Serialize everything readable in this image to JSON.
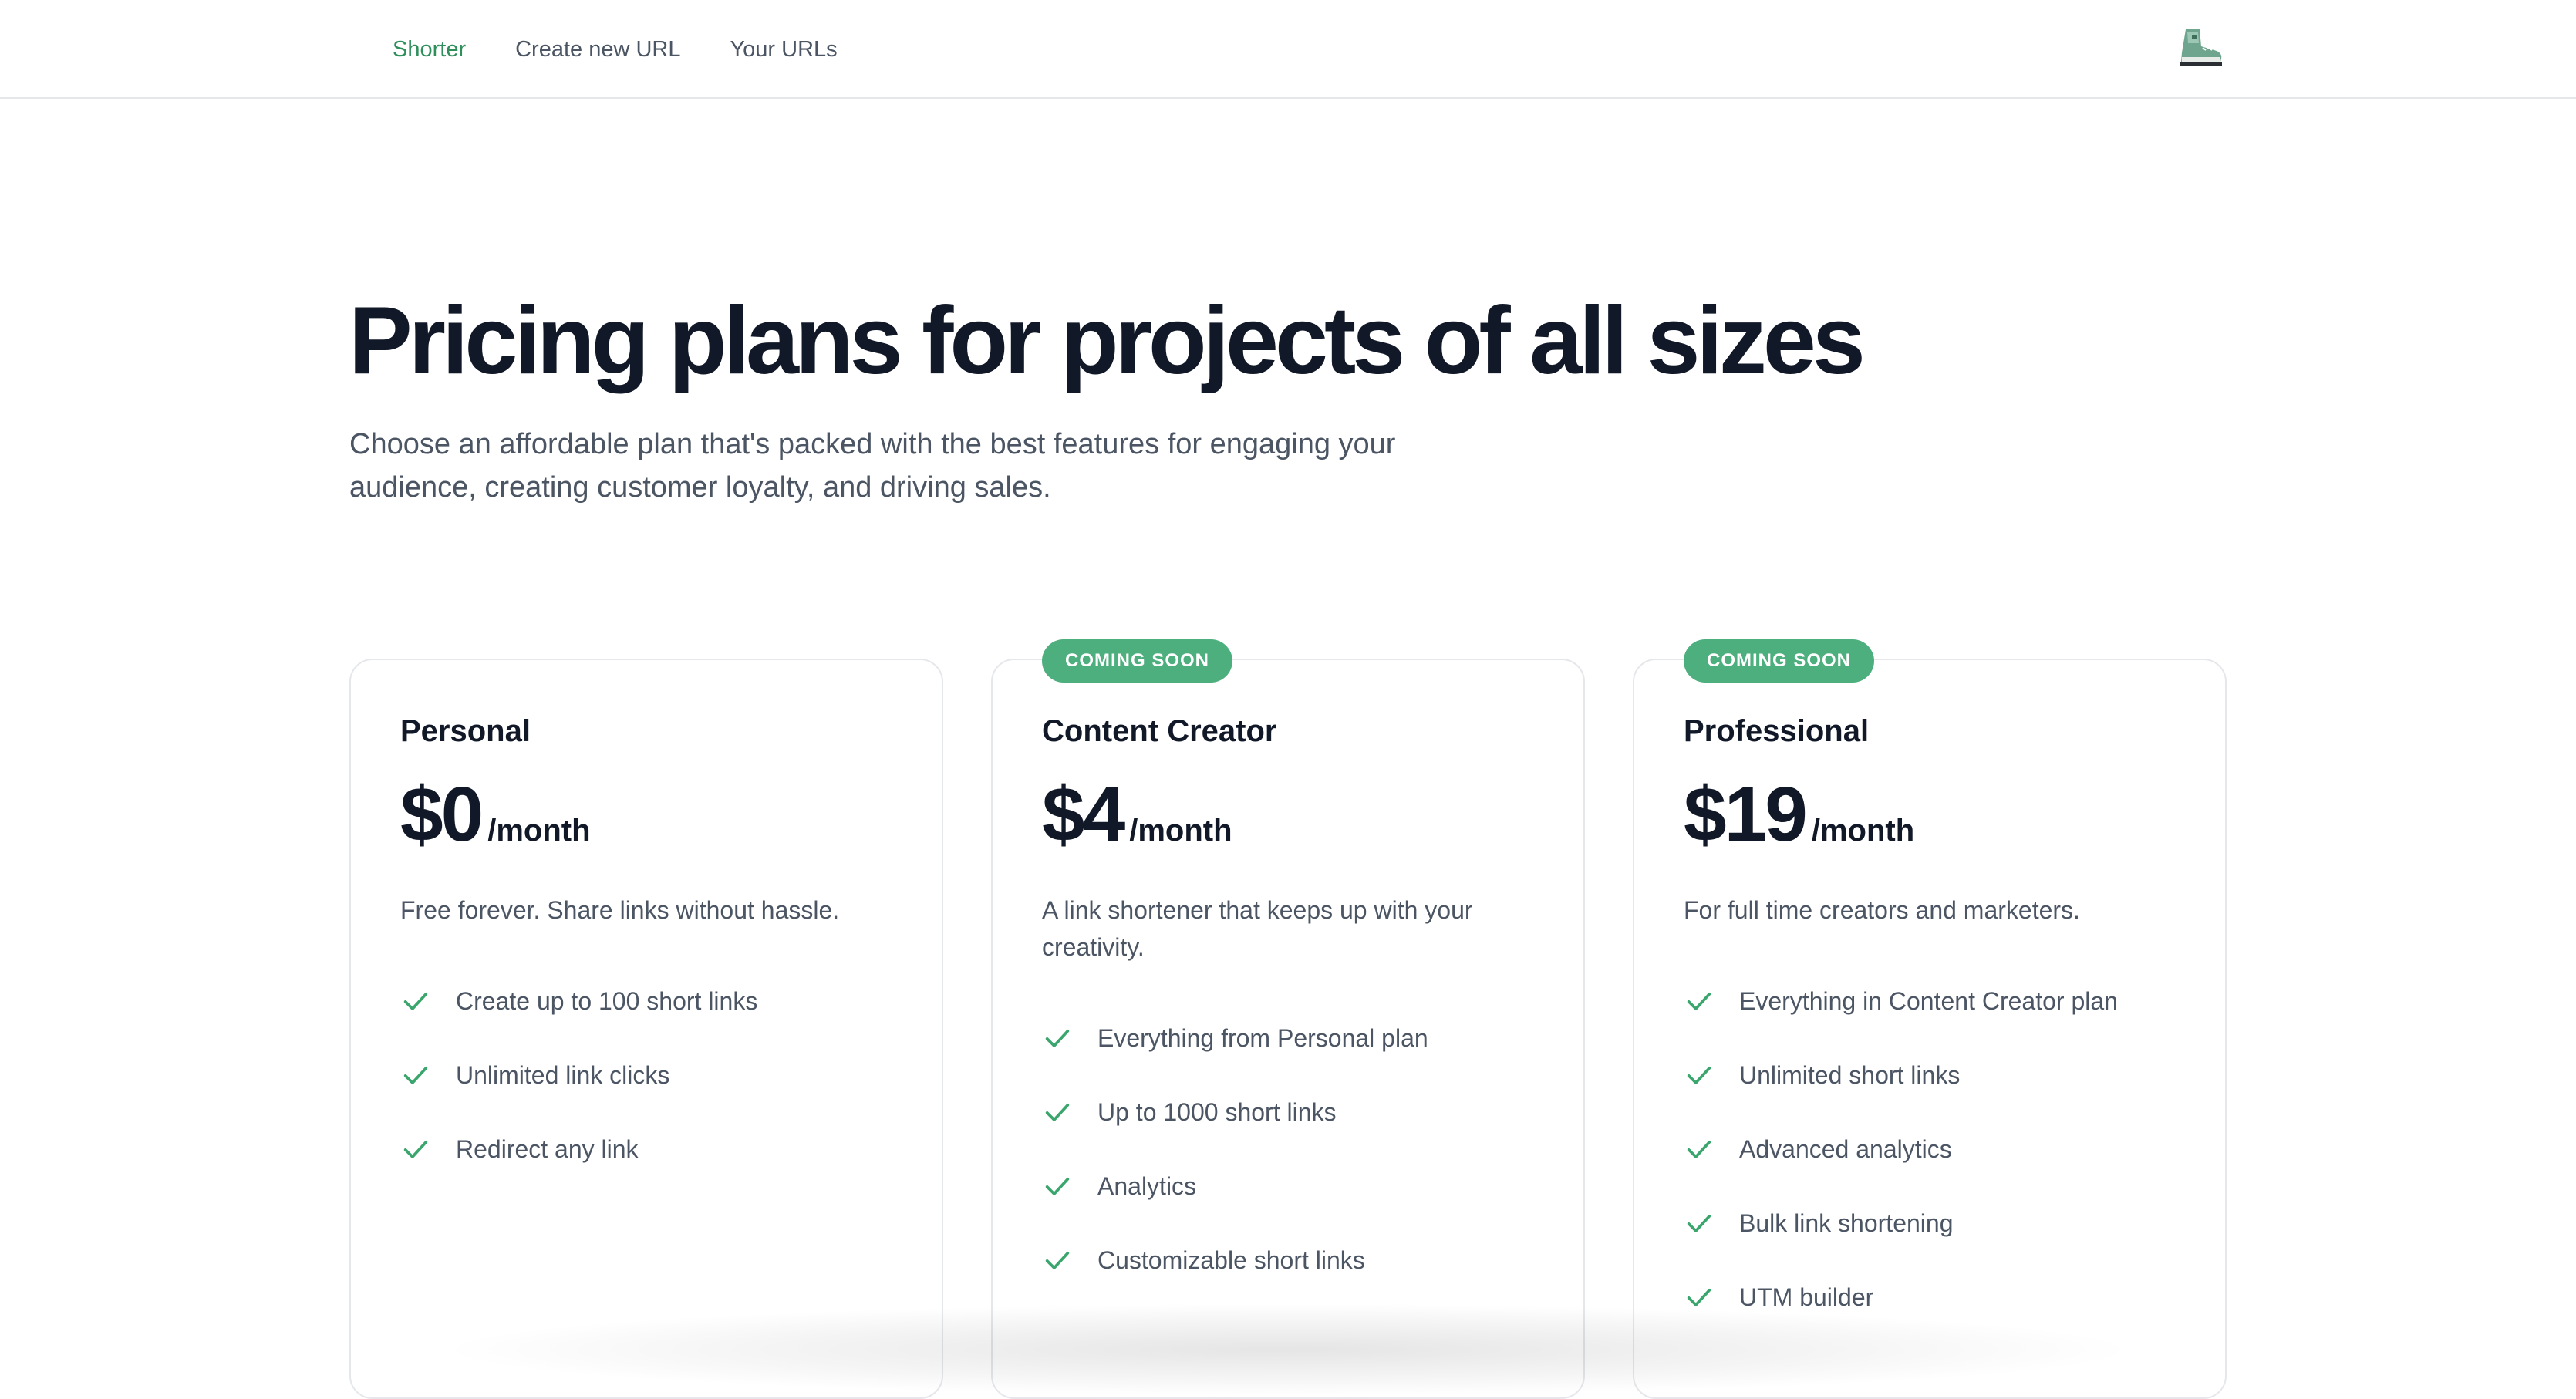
{
  "nav": {
    "brand": "Shorter",
    "links": [
      "Create new URL",
      "Your URLs"
    ],
    "avatar_icon": "shoe-icon"
  },
  "hero": {
    "title": "Pricing plans for projects of all sizes",
    "subtitle": "Choose an affordable plan that's packed with the best features for engaging your audience, creating customer loyalty, and driving sales."
  },
  "colors": {
    "accent": "#2f8f5b",
    "badge": "#4caf7d",
    "check": "#3aa56c"
  },
  "plans": [
    {
      "badge": "",
      "name": "Personal",
      "price": "$0",
      "period": "/month",
      "description": "Free forever. Share links without hassle.",
      "features": [
        "Create up to 100 short links",
        "Unlimited link clicks",
        "Redirect any link"
      ]
    },
    {
      "badge": "COMING SOON",
      "name": "Content Creator",
      "price": "$4",
      "period": "/month",
      "description": "A link shortener that keeps up with your creativity.",
      "features": [
        "Everything from Personal plan",
        "Up to 1000 short links",
        "Analytics",
        "Customizable short links"
      ]
    },
    {
      "badge": "COMING SOON",
      "name": "Professional",
      "price": "$19",
      "period": "/month",
      "description": "For full time creators and marketers.",
      "features": [
        "Everything in Content Creator plan",
        "Unlimited short links",
        "Advanced analytics",
        "Bulk link shortening",
        "UTM builder"
      ]
    }
  ]
}
